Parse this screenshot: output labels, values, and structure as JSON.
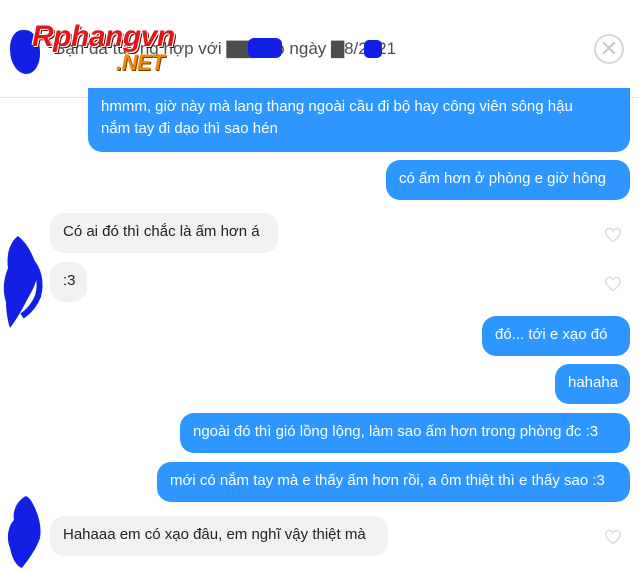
{
  "header": {
    "match_text": "Bạn đã tương hợp với ▇▇ vào ngày ▇8/2021",
    "close_symbol": "✕",
    "watermark_main": "Rphangvn",
    "watermark_sub": ".NET"
  },
  "messages": [
    {
      "side": "sent",
      "lines": [
        "hmmm, giờ này mà lang thang ngoài cầu đi bộ hay công viên sông hậu",
        "nắm tay đi dạo thì sao hén"
      ]
    },
    {
      "side": "sent",
      "lines": [
        "có ấm hơn ở phòng e giờ hông"
      ]
    },
    {
      "side": "received",
      "lines": [
        "Có ai đó thì chắc là ấm hơn á"
      ]
    },
    {
      "side": "received",
      "lines": [
        ":3"
      ]
    },
    {
      "side": "sent",
      "lines": [
        "đó... tới e xạo đó"
      ]
    },
    {
      "side": "sent",
      "lines": [
        "hahaha"
      ]
    },
    {
      "side": "sent",
      "lines": [
        "ngoài đó thì gió lồng lộng, làm sao ấm hơn trong phòng đc :3"
      ]
    },
    {
      "side": "sent",
      "lines": [
        "mới có nắm tay mà e thấy ấm hơn rồi, a ôm thiệt thì e thấy sao :3"
      ]
    },
    {
      "side": "received",
      "lines": [
        "Hahaaa em có xạo đâu, em nghĩ vậy thiệt mà"
      ]
    }
  ],
  "colors": {
    "sent_bubble": "#2e96ff",
    "received_bubble": "#f1f1f3",
    "redaction": "#1220e6"
  },
  "icons": {
    "like": "heart-outline-icon",
    "close": "close-icon"
  }
}
